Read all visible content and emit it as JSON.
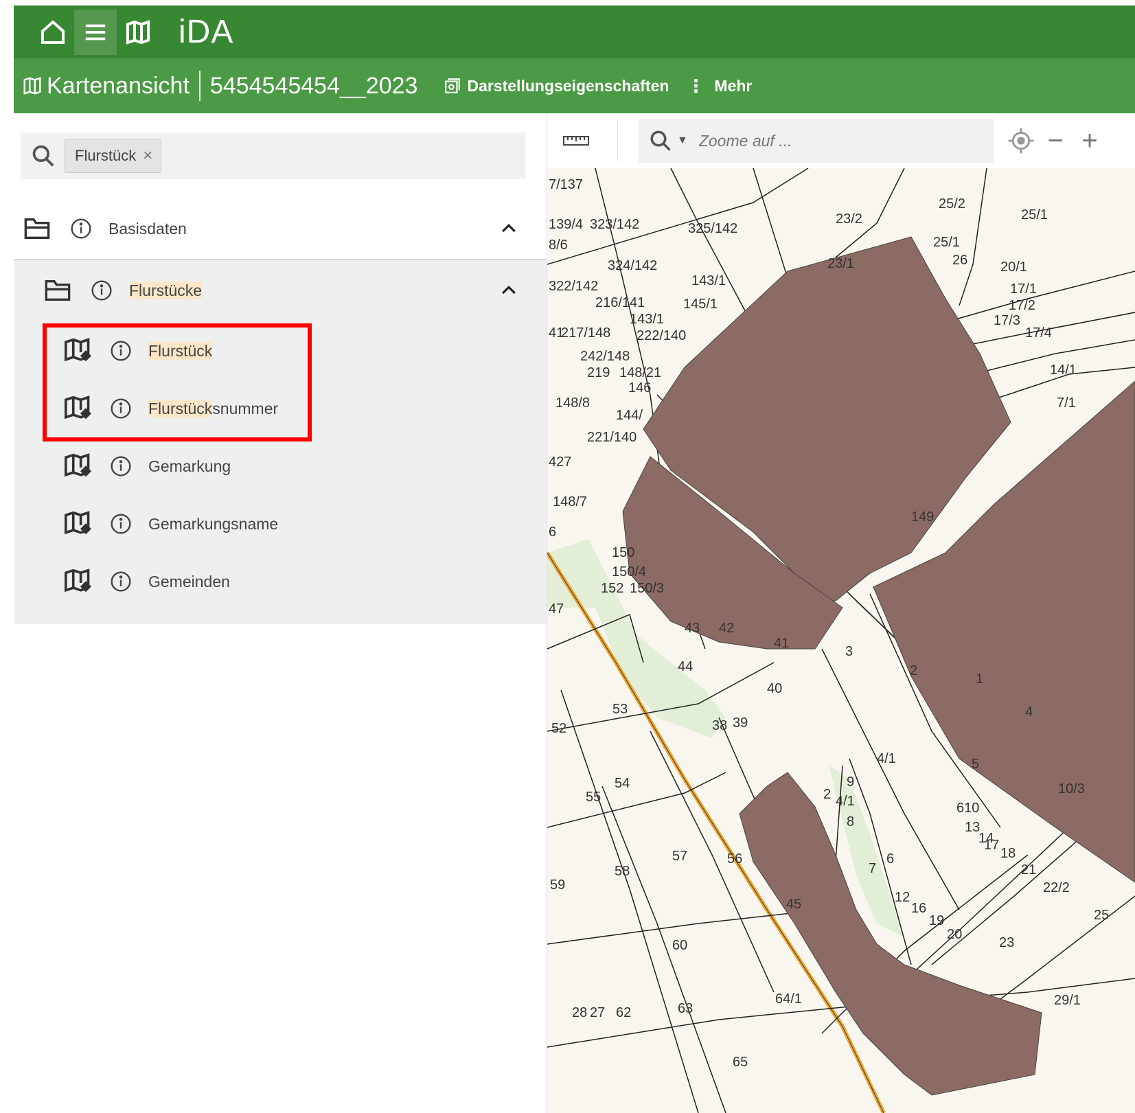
{
  "app": {
    "title": "iDA"
  },
  "topbar": {
    "icons": [
      "home-icon",
      "menu-icon",
      "map-icon"
    ]
  },
  "subbar": {
    "view_label": "Kartenansicht",
    "project_name": "5454545454__2023",
    "display_props_label": "Darstellungseigenschaften",
    "more_label": "Mehr"
  },
  "search": {
    "chip_label": "Flurstück"
  },
  "tree": {
    "basis": {
      "label": "Basisdaten"
    },
    "group": {
      "label_highlight": "Flurstücke",
      "label_rest": ""
    },
    "items": [
      {
        "highlight": "Flurstück",
        "rest": ""
      },
      {
        "highlight": "Flurstück",
        "rest": "snummer"
      },
      {
        "highlight": "",
        "rest": "Gemarkung"
      },
      {
        "highlight": "",
        "rest": "Gemarkungsname"
      },
      {
        "highlight": "",
        "rest": "Gemeinden"
      }
    ]
  },
  "map": {
    "zoom_placeholder": "Zoome auf ...",
    "parcel_color": "#8c6b64",
    "parcel_labels": [
      "7/137",
      "139/4",
      "323/142",
      "325/142",
      "23/2",
      "25/2",
      "25/1",
      "8/6",
      "324/142",
      "23/1",
      "25/1",
      "26",
      "20/1",
      "322/142",
      "143/1",
      "216/141",
      "145/1",
      "17/1",
      "17/2",
      "17/3",
      "17/4",
      "143/1",
      "41",
      "217/148",
      "222/140",
      "242/148",
      "14/1",
      "219",
      "148/21",
      "146",
      "148/8",
      "144/",
      "7/1",
      "221/140",
      "427",
      "148/7",
      "6",
      "149",
      "150",
      "150/4",
      "152",
      "150/3",
      "47",
      "43",
      "42",
      "41",
      "3",
      "2",
      "1",
      "44",
      "40",
      "53",
      "52",
      "38",
      "39",
      "4",
      "4/1",
      "5",
      "54",
      "55",
      "610",
      "13",
      "14",
      "17",
      "9",
      "2",
      "4/1",
      "8",
      "10/3",
      "18",
      "21",
      "22/2",
      "57",
      "56",
      "58",
      "59",
      "6",
      "7",
      "12",
      "16",
      "19",
      "20",
      "45",
      "23",
      "60",
      "25",
      "64/1",
      "63",
      "62",
      "28",
      "27",
      "29/1",
      "65"
    ]
  },
  "colors": {
    "topbar": "#388733",
    "subbar": "#4b9a45",
    "highlight": "#fbe7c8",
    "redbox": "#ff0000"
  }
}
